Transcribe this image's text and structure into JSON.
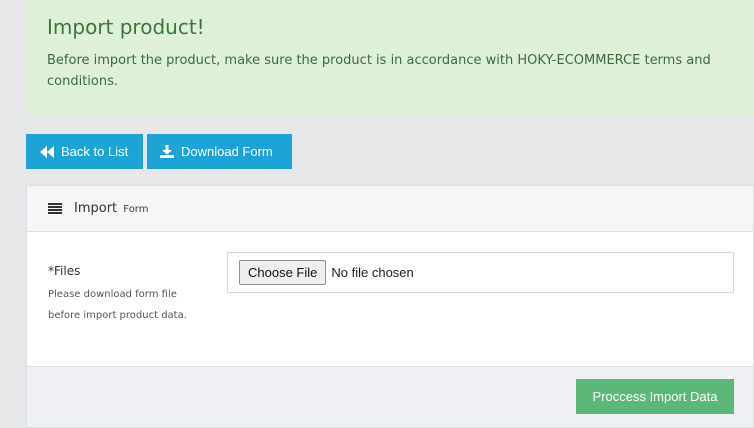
{
  "alert": {
    "title": "Import product!",
    "text": "Before import the product, make sure the product is in accordance with HOKY-ECOMMERCE terms and conditions."
  },
  "toolbar": {
    "back_label": "Back to List",
    "download_label": "Download Form"
  },
  "panel": {
    "title": "Import",
    "title_small": "Form",
    "field_label": "*Files",
    "field_help_line1": "Please download form file",
    "field_help_line2": "before import product data.",
    "file_button_label": "Choose File",
    "file_status": "No file chosen",
    "submit_label": "Proccess Import Data"
  },
  "colors": {
    "primary": "#1ea3d6",
    "success": "#5cb878",
    "alert_bg": "#dff0d8",
    "alert_text": "#3c763d"
  },
  "icons": {
    "back": "fast-backward-icon",
    "download": "download-icon",
    "panel": "list-icon"
  }
}
